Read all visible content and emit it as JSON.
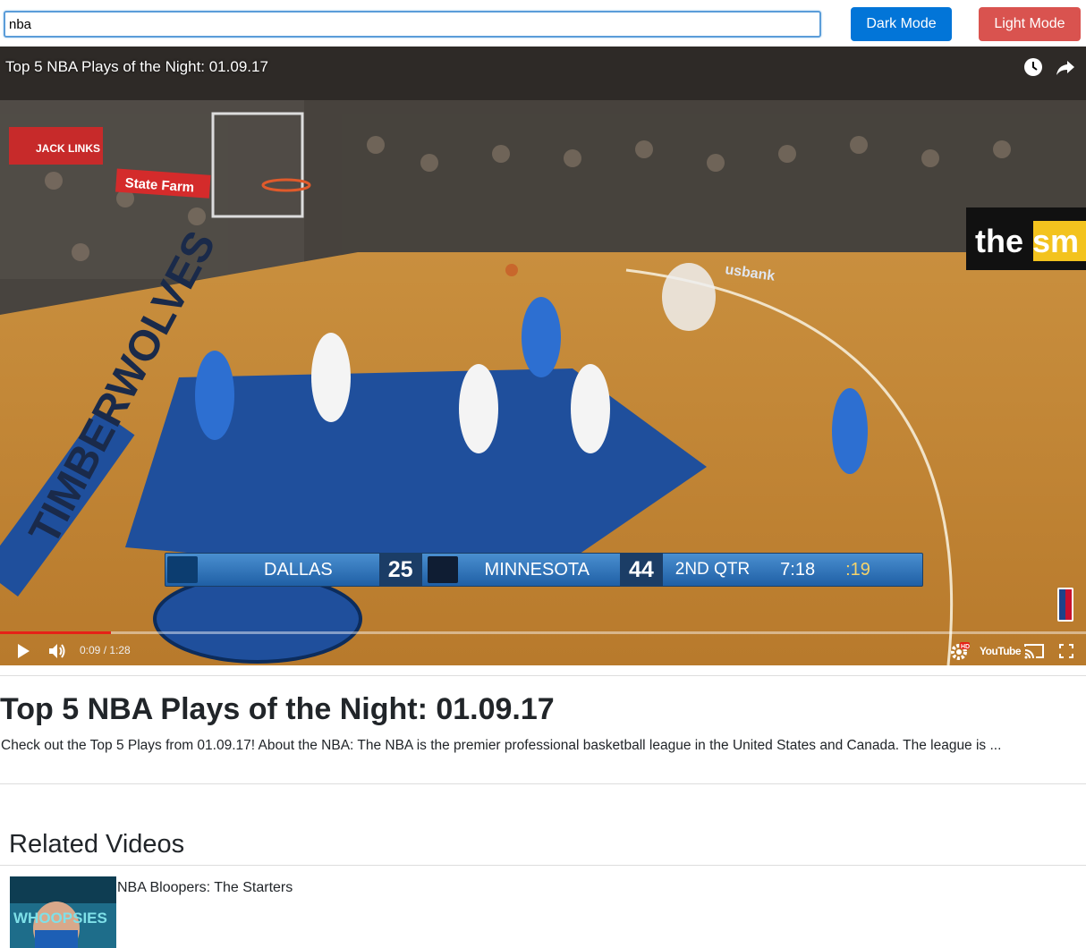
{
  "search": {
    "value": "nba"
  },
  "buttons": {
    "dark": "Dark Mode",
    "light": "Light Mode"
  },
  "player": {
    "overlay_title": "Top 5 NBA Plays of the Night: 01.09.17",
    "time": "0:09 / 1:28",
    "progress": 0.102,
    "icons": [
      "watch-later-icon",
      "share-icon",
      "play-icon",
      "volume-icon",
      "settings-icon",
      "youtube-logo",
      "cast-icon",
      "fullscreen-icon"
    ],
    "youtube_label": "YouTube",
    "hd_badge": "HD",
    "scoreboard": {
      "team_a": "DALLAS",
      "score_a": "25",
      "team_b": "MINNESOTA",
      "score_b": "44",
      "quarter": "2ND QTR",
      "clock": "7:18",
      "shot_clock": ":19"
    },
    "signage": [
      "JACK LINKS",
      "State Farm",
      "the sm",
      "usbank",
      "TIMBERWOLVES"
    ]
  },
  "video": {
    "title": "Top 5 NBA Plays of the Night: 01.09.17",
    "description": "Check out the Top 5 Plays from 01.09.17! About the NBA: The NBA is the premier professional basketball league in the United States and Canada. The league is ..."
  },
  "related": {
    "heading": "Related Videos",
    "items": [
      {
        "title": "NBA Bloopers: The Starters",
        "thumb_text": "WHOOPSIES"
      }
    ]
  },
  "colors": {
    "dark_button": "#0275d8",
    "light_button": "#d9534f",
    "progress": "#e62117"
  }
}
